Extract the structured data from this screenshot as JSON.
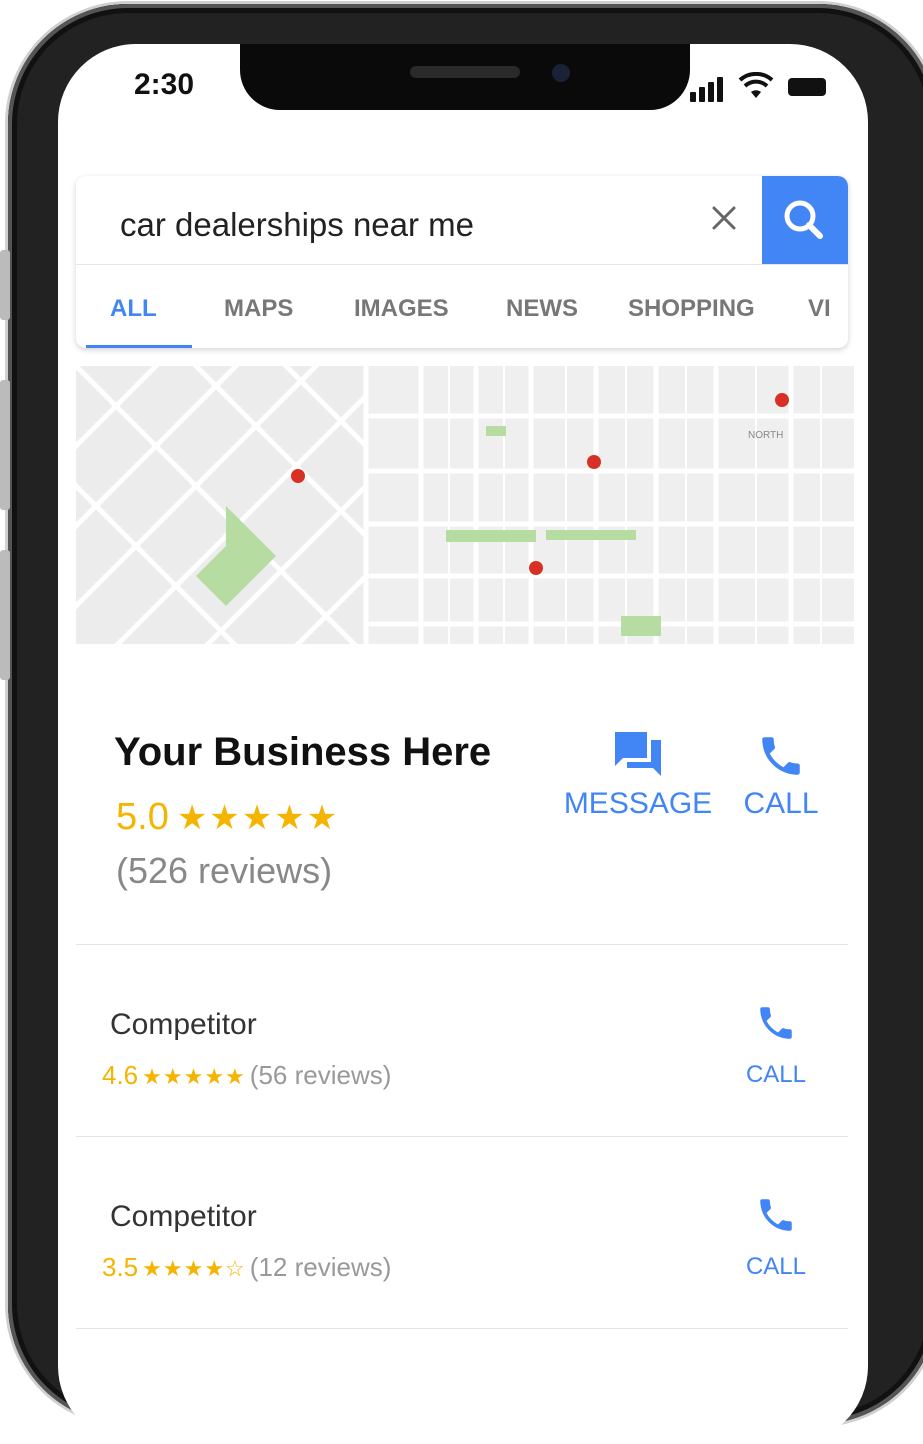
{
  "status_bar": {
    "time": "2:30"
  },
  "search": {
    "query": "car dealerships near me",
    "tabs": [
      {
        "label": "ALL",
        "active": true
      },
      {
        "label": "MAPS",
        "active": false
      },
      {
        "label": "IMAGES",
        "active": false
      },
      {
        "label": "NEWS",
        "active": false
      },
      {
        "label": "SHOPPING",
        "active": false
      },
      {
        "label": "VI",
        "active": false
      }
    ]
  },
  "map": {
    "labels": {
      "north": "NORTH"
    }
  },
  "featured_business": {
    "name": "Your Business Here",
    "rating": "5.0",
    "stars": "★★★★★",
    "reviews": "(526 reviews)",
    "message_label": "MESSAGE",
    "call_label": "CALL"
  },
  "competitors": [
    {
      "name": "Competitor",
      "rating": "4.6",
      "stars": "★★★★★",
      "reviews": "(56 reviews)",
      "call_label": "CALL"
    },
    {
      "name": "Competitor",
      "rating": "3.5",
      "stars": "★★★★☆",
      "reviews": "(12 reviews)",
      "call_label": "CALL"
    }
  ],
  "colors": {
    "accent": "#4285f4",
    "star": "#f4b400",
    "pin": "#d93025",
    "park": "#b7dca1"
  },
  "icons": {
    "search": "search-icon",
    "clear": "close-icon",
    "message": "message-icon",
    "call": "phone-icon"
  }
}
